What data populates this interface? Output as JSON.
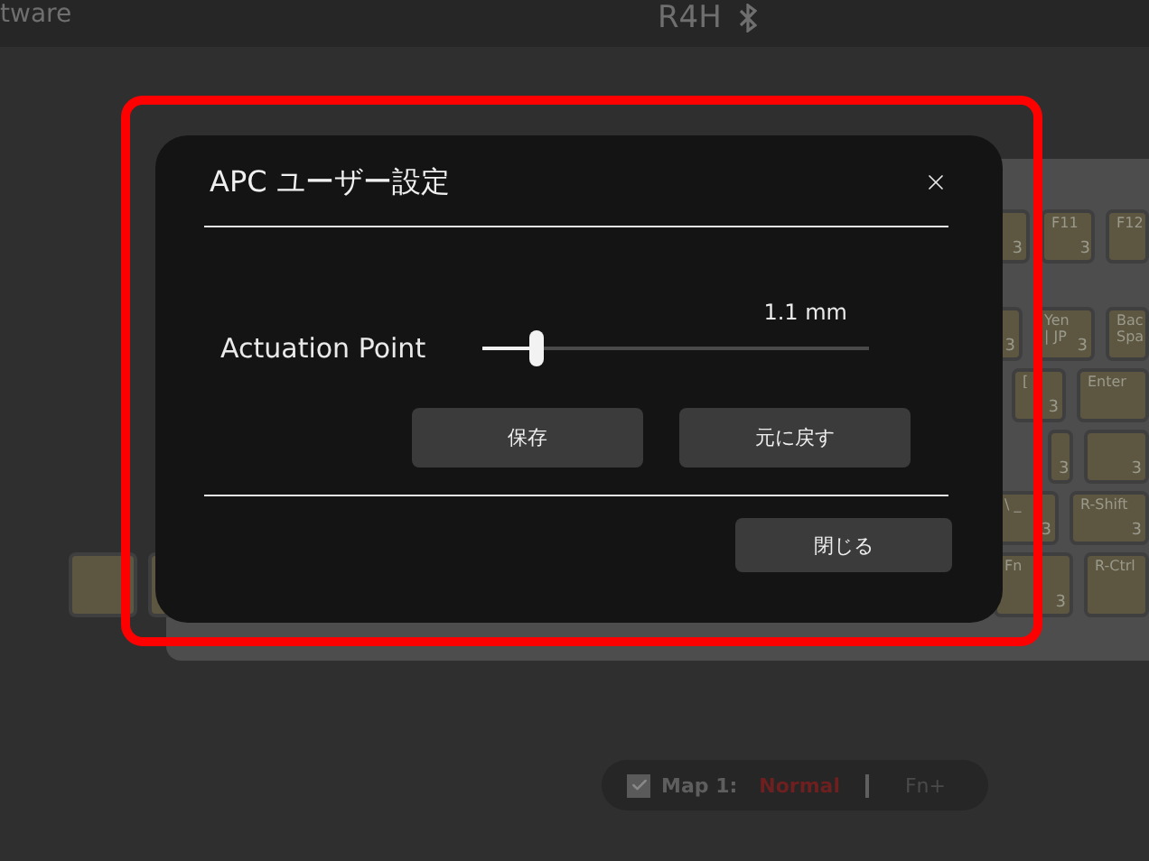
{
  "header": {
    "app_title": "tware",
    "device": "R4H"
  },
  "keyboard": {
    "rows": [
      [
        {
          "value": "3"
        },
        {
          "label": "F11",
          "value": "3"
        },
        {
          "label": "F12"
        }
      ],
      [
        {
          "value": "3"
        },
        {
          "label": "Yen | JP",
          "value": "3"
        },
        {
          "label": "Bac Spa"
        }
      ],
      [
        {
          "label": "[",
          "value": "3"
        },
        {
          "label": "Enter"
        }
      ],
      [
        {
          "value": "3"
        },
        {
          "value": "3"
        }
      ],
      [
        {
          "label": "\\ _",
          "value": "3"
        },
        {
          "label": "R-Shift",
          "value": "3"
        }
      ],
      [
        {
          "label": "Fn",
          "value": "3"
        },
        {
          "label": "R-Ctrl"
        }
      ]
    ]
  },
  "dialog": {
    "title": "APC ユーザー設定",
    "setting": {
      "label": "Actuation Point",
      "reading": "1.1 mm",
      "level": 0.14
    },
    "buttons": [
      "保存",
      "元に戻す"
    ],
    "close_button": "閉じる"
  },
  "map_bar": {
    "checked": true,
    "label": "Map 1:",
    "mode": "Normal",
    "alt_mode": "Fn+"
  }
}
